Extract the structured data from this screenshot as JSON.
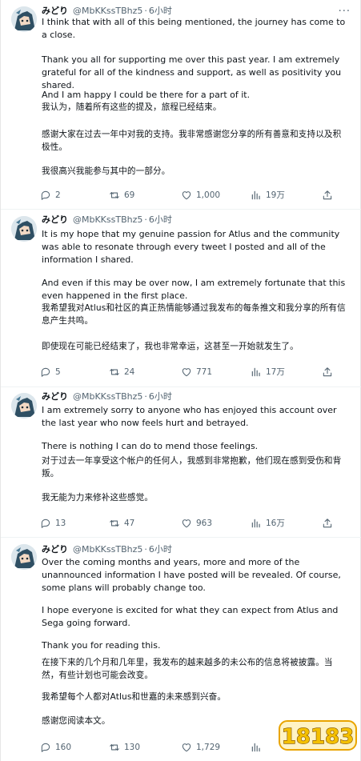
{
  "tweets": [
    {
      "user": {
        "name": "みどり",
        "handle": "@MbKKssTBhz5",
        "time": "6小时"
      },
      "paragraphs": [
        "I think that with all of this being mentioned, the journey has come to a close.",
        "Thank you all for supporting me over this past year. I am extremely grateful for all of the kindness and support, as well as positivity you shared.",
        "And I am happy I could be there for a part of it.",
        "我认为，随着所有这些的提及，旅程已经结束。",
        "感谢大家在过去一年中对我的支持。我非常感谢您分享的所有善意和支持以及积极性。",
        "我很高兴我能参与其中的一部分。"
      ],
      "stats": {
        "replies": "2",
        "retweets": "69",
        "likes": "1,000",
        "views": "19万"
      }
    },
    {
      "user": {
        "name": "みどり",
        "handle": "@MbKKssTBhz5",
        "time": "6小时"
      },
      "paragraphs": [
        "It is my hope that my genuine passion for Atlus and the community was able to resonate through every tweet I posted and all of the information I shared.",
        "And even if this may be over now, I am extremely fortunate that this even happened in the first place.",
        "我希望我对Atlus和社区的真正热情能够通过我发布的每条推文和我分享的所有信息产生共鸣。",
        "即使现在可能已经结束了，我也非常幸运，这甚至一开始就发生了。"
      ],
      "stats": {
        "replies": "5",
        "retweets": "24",
        "likes": "771",
        "views": "17万"
      }
    },
    {
      "user": {
        "name": "みどり",
        "handle": "@MbKKssTBhz5",
        "time": "6小时"
      },
      "paragraphs": [
        "I am extremely sorry to anyone who has enjoyed this account over the last year who now feels hurt and betrayed.",
        "There is nothing I can do to mend those feelings.",
        "对于过去一年享受这个帐户的任何人，我感到非常抱歉，他们现在感到受伤和背叛。",
        "我无能为力来修补这些感觉。"
      ],
      "stats": {
        "replies": "13",
        "retweets": "47",
        "likes": "963",
        "views": "16万"
      }
    },
    {
      "user": {
        "name": "みどり",
        "handle": "@MbKKssTBhz5",
        "time": "6小时"
      },
      "paragraphs": [
        "Over the coming months and years, more and more of the unannounced information I have posted will be revealed. Of course, some plans will probably change too.",
        "I hope everyone is excited for what they can expect from Atlus and Sega going forward.",
        "Thank you for reading this.",
        "在接下来的几个月和几年里，我发布的越来越多的未公布的信息将被披露。当然，有些计划也可能会改变。",
        "我希望每个人都对Atlus和世嘉的未来感到兴奋。",
        "感谢您阅读本文。"
      ],
      "stats": {
        "replies": "160",
        "retweets": "130",
        "likes": "1,729",
        "views": ""
      }
    }
  ],
  "icons": {
    "reply": "reply-icon",
    "retweet": "retweet-icon",
    "like": "heart-icon",
    "views": "views-icon",
    "share": "share-icon",
    "more": "more-icon",
    "bookmark": "bookmark-icon"
  },
  "watermark": {
    "text": "18183"
  },
  "colors": {
    "text": "#0f1419",
    "muted": "#536471",
    "divider": "#eff3f4",
    "thread_line": "#cfd9de",
    "watermark_fill": "#f4c000"
  }
}
